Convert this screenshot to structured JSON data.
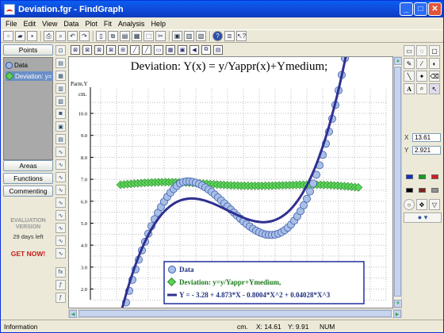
{
  "window": {
    "title": "Deviation.fgr - FindGraph"
  },
  "menu": [
    "File",
    "Edit",
    "View",
    "Data",
    "Plot",
    "Fit",
    "Analysis",
    "Help"
  ],
  "left": {
    "points_btn": "Points",
    "areas_btn": "Areas",
    "functions_btn": "Functions",
    "commenting_btn": "Commenting",
    "list": [
      {
        "label": "Data",
        "kind": "circle"
      },
      {
        "label": "Deviation: y=",
        "kind": "diamond"
      }
    ],
    "eval_line1": "EVALUATION",
    "eval_line2": "VERSION",
    "eval_days": "29 days left",
    "get_now": "GET NOW!"
  },
  "graph": {
    "title": "Deviation: Y(x) = y/Yappr(x)+Ymedium;",
    "yaxis_label1": "Parm.Y",
    "yaxis_label2": "cm.",
    "yticks": [
      "10.0",
      "9.0",
      "8.0",
      "7.0",
      "6.0",
      "5.0",
      "4.0",
      "3.0",
      "2.0"
    ],
    "legend": {
      "data": "Data",
      "deviation": "Deviation: y=y/Yappr+Ymedium,",
      "fit": "Y =  - 3.28 + 4.873*X - 0.8004*X^2 + 0.04028*X^3"
    }
  },
  "right": {
    "x_label": "X",
    "x_value": "13.61",
    "y_label": "Y",
    "y_value": "2.921"
  },
  "status": {
    "left": "Information",
    "unit": "cm.",
    "x": "X: 14.61",
    "y": "Y: 9.91",
    "mode": "NUM"
  },
  "colors": {
    "data_fill": "#a8bfe6",
    "data_stroke": "#4060b0",
    "deviation": "#5cd25a",
    "fit": "#303090",
    "legend_border": "#2030a0"
  },
  "icons": [
    "new-icon",
    "open-icon",
    "save-icon",
    "print-icon",
    "undo-icon",
    "redo-icon",
    "help-icon"
  ]
}
